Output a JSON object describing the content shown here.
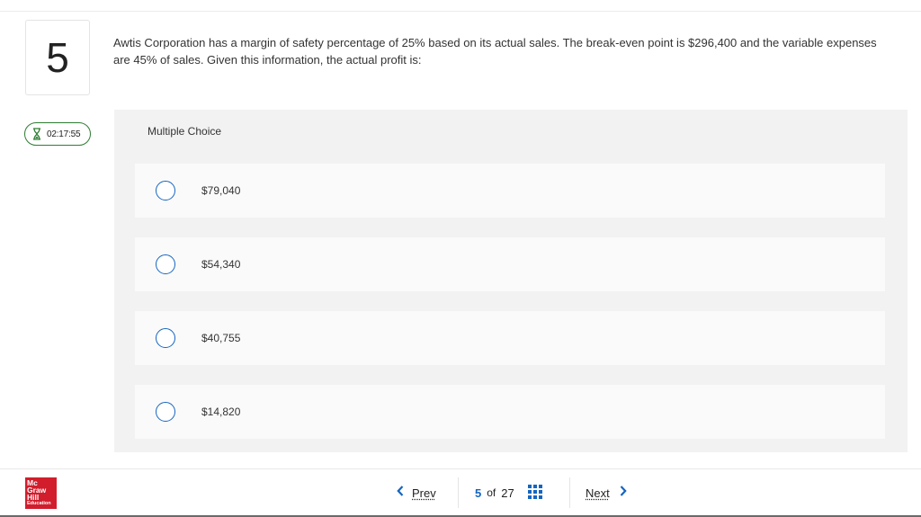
{
  "question": {
    "number": "5",
    "text": "Awtis Corporation has a margin of safety percentage of 25% based on its actual sales. The break-even point is $296,400 and the variable expenses are 45% of sales. Given this information, the actual profit is:"
  },
  "timer": {
    "value": "02:17:55",
    "icon": "hourglass-icon"
  },
  "multiple_choice": {
    "label": "Multiple Choice",
    "options": [
      {
        "label": "$79,040"
      },
      {
        "label": "$54,340"
      },
      {
        "label": "$40,755"
      },
      {
        "label": "$14,820"
      }
    ]
  },
  "footer": {
    "logo_lines": [
      "Mc",
      "Graw",
      "Hill",
      "Education"
    ],
    "prev_label": "Prev",
    "current_page": "5",
    "of_label": "of",
    "total_pages": "27",
    "next_label": "Next"
  },
  "colors": {
    "accent_blue": "#1565c0",
    "timer_green": "#2e7d32",
    "logo_red": "#d21d2c",
    "panel_gray": "#f2f2f2"
  }
}
